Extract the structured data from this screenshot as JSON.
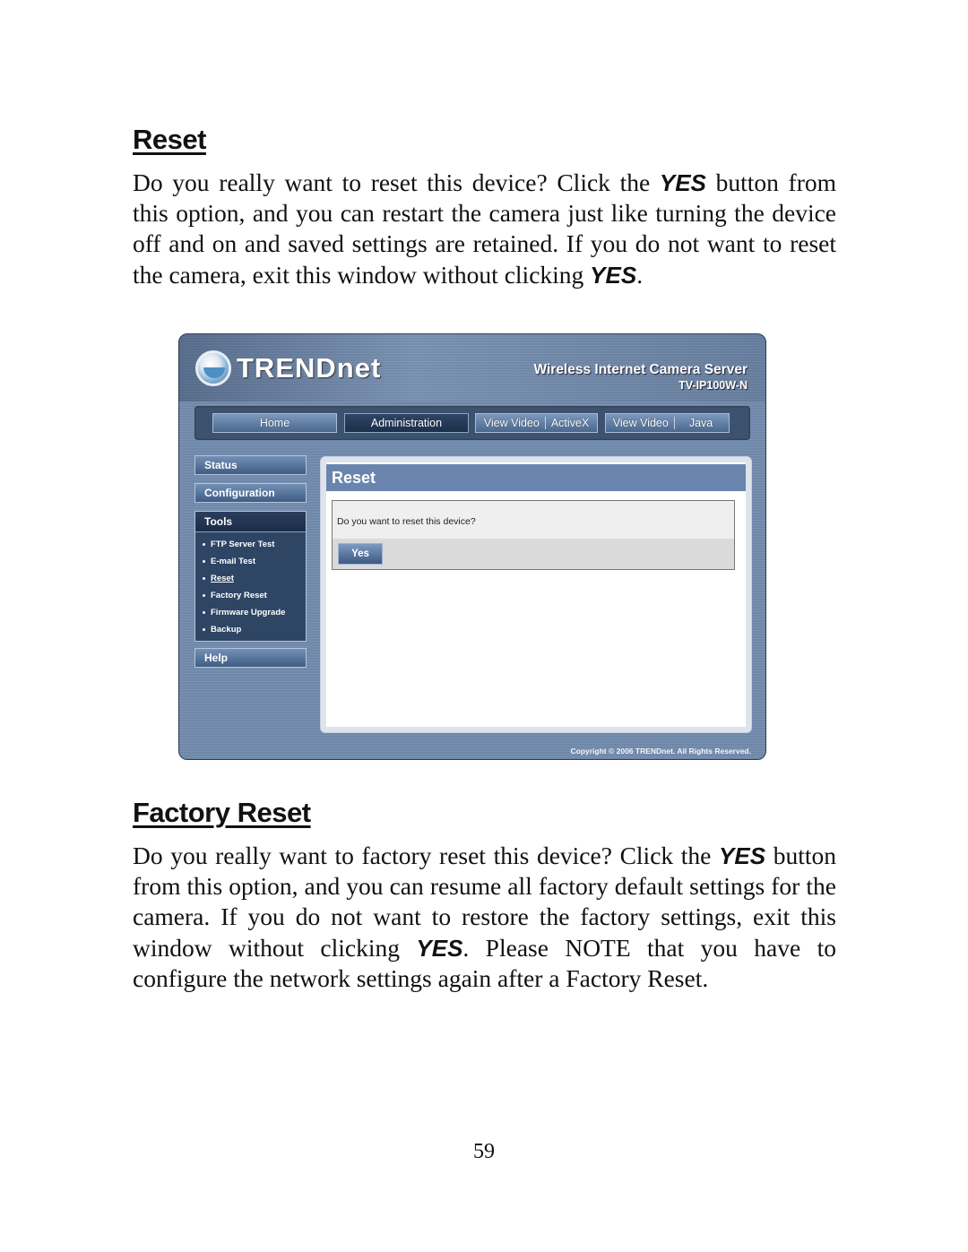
{
  "sections": [
    {
      "heading": "Reset",
      "paragraph_parts": [
        "Do you really want to reset this device?  Click the ",
        "YES",
        " button from this option, and you can restart the camera just like turning the device off and on and saved settings are retained.  If you do not want to reset the camera, exit this window without clicking ",
        "YES",
        "."
      ]
    },
    {
      "heading": "Factory Reset",
      "paragraph_parts": [
        "Do you really want to factory reset this device?  Click the ",
        "YES",
        " button from this option, and you can resume all factory default settings for the camera.  If you do not want to restore the factory settings, exit this window without clicking ",
        "YES",
        ".  Please NOTE that you have to configure the network settings again after a Factory Reset."
      ]
    }
  ],
  "screenshot": {
    "brand": "TRENDnet",
    "product_title": "Wireless Internet Camera Server",
    "model": "TV-IP100W-N",
    "nav": {
      "home": "Home",
      "administration": "Administration",
      "view_video_activex": [
        "View Video",
        "ActiveX"
      ],
      "view_video_java": [
        "View Video",
        "Java"
      ]
    },
    "sidebar": {
      "status": "Status",
      "configuration": "Configuration",
      "tools": "Tools",
      "tools_items": [
        "FTP Server Test",
        "E-mail Test",
        "Reset",
        "Factory Reset",
        "Firmware Upgrade",
        "Backup"
      ],
      "current_item": "Reset",
      "help": "Help"
    },
    "panel": {
      "title": "Reset",
      "question": "Do you want to reset this device?",
      "yes_button": "Yes"
    },
    "copyright": "Copyright © 2006 TRENDnet. All Rights Reserved."
  },
  "page_number": "59"
}
